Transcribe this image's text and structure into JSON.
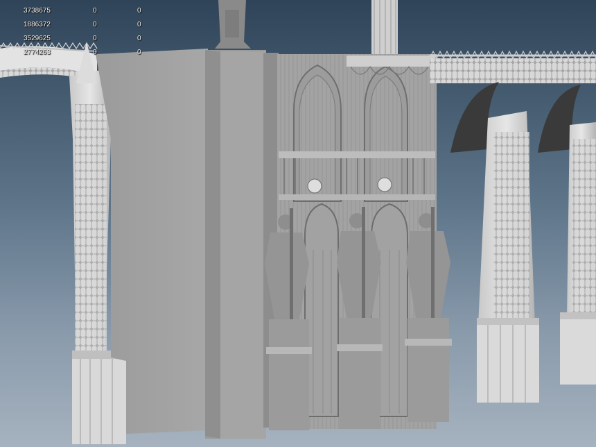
{
  "viewport": {
    "background_top": "#2f4458",
    "background_bottom": "#a6b2bf",
    "model_color": "#a9a9a9"
  },
  "hud": {
    "rows": [
      {
        "a": "3738675",
        "b": "0",
        "c": "0"
      },
      {
        "a": "1886372",
        "b": "0",
        "c": "0"
      },
      {
        "a": "3529625",
        "b": "0",
        "c": "0"
      },
      {
        "a": "2774263",
        "b": "0",
        "c": "0"
      }
    ]
  }
}
